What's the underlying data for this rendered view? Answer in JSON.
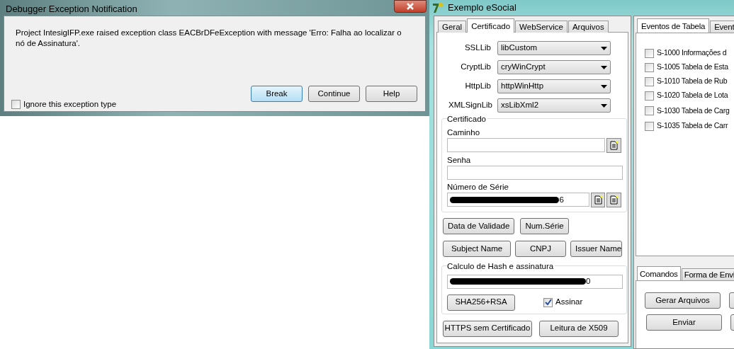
{
  "dialog": {
    "title": "Debugger Exception Notification",
    "message": "Project IntesigIFP.exe raised exception class EACBrDFeException with message 'Erro: Falha ao localizar o nó de Assinatura'.",
    "buttons": [
      {
        "label": "Break",
        "default": true
      },
      {
        "label": "Continue",
        "default": false
      },
      {
        "label": "Help",
        "default": false
      }
    ],
    "ignore_checkbox": {
      "label": "Ignore this exception type",
      "checked": false
    }
  },
  "app": {
    "title": "Exemplo eSocial",
    "tabs": [
      {
        "label": "Geral",
        "selected": false
      },
      {
        "label": "Certificado",
        "selected": true
      },
      {
        "label": "WebService",
        "selected": false
      },
      {
        "label": "Arquivos",
        "selected": false
      }
    ],
    "settings": [
      {
        "label": "SSLLib",
        "value": "libCustom"
      },
      {
        "label": "CryptLib",
        "value": "cryWinCrypt"
      },
      {
        "label": "HttpLib",
        "value": "httpWinHttp"
      },
      {
        "label": "XMLSignLib",
        "value": "xsLibXml2"
      }
    ],
    "certificate_group": {
      "title": "Certificado",
      "path_label": "Caminho",
      "password_label": "Senha",
      "serial_label": "Número de Série",
      "serial_value": {
        "redacted": true,
        "visible": "6"
      }
    },
    "button_rows": [
      [
        "Data de Validade",
        "Num.Série"
      ],
      [
        "Subject Name",
        "CNPJ",
        "Issuer Name"
      ]
    ],
    "hash_group": {
      "title": "Calculo de Hash e assinatura",
      "value": {
        "redacted": true,
        "visible": "0"
      },
      "button": "SHA256+RSA",
      "sign_checkbox": {
        "label": "Assinar",
        "checked": true
      }
    },
    "bottom_buttons": [
      "HTTPS sem Certificado",
      "Leitura de X509"
    ],
    "event_tabs": [
      {
        "label": "Eventos de Tabela",
        "selected": true
      },
      {
        "label": "Event",
        "selected": false
      }
    ],
    "events": [
      {
        "label": "S-1000 Informações d",
        "checked": false
      },
      {
        "label": "S-1005 Tabela de Esta",
        "checked": false
      },
      {
        "label": "S-1010 Tabela de Rub",
        "checked": false
      },
      {
        "label": "S-1020 Tabela de Lota",
        "checked": false
      },
      {
        "label": "S-1030 Tabela de Carg",
        "checked": false
      },
      {
        "label": "S-1035 Tabela de Carr",
        "checked": false
      }
    ],
    "command_tabs": [
      {
        "label": "Comandos",
        "selected": true
      },
      {
        "label": "Forma de Envi",
        "selected": false
      }
    ],
    "commands": [
      "Gerar Arquivos",
      "Enviar"
    ]
  }
}
